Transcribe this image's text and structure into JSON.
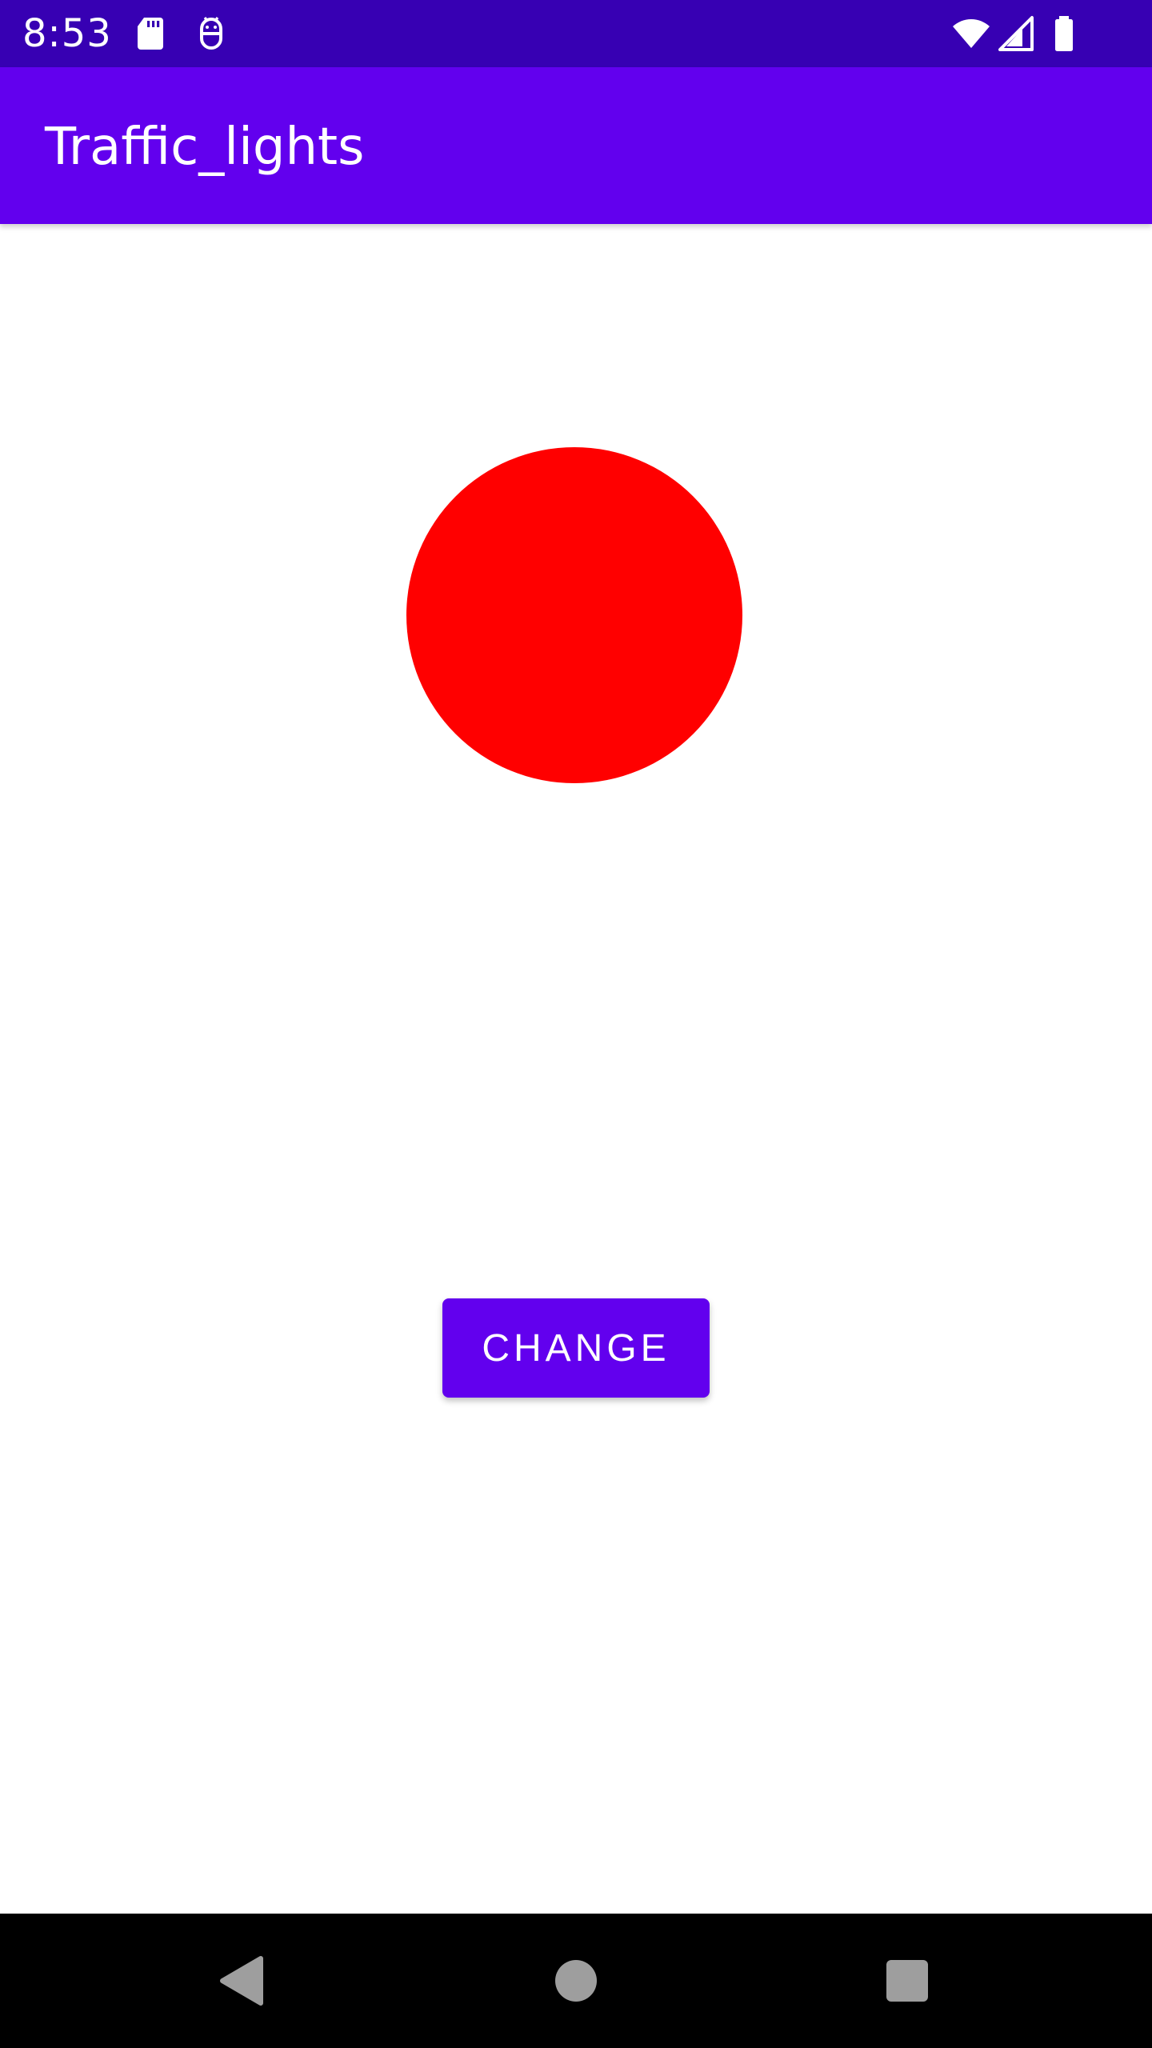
{
  "status_bar": {
    "time": "8:53",
    "icons": [
      "sd-card-icon",
      "android-debug-icon",
      "wifi-icon",
      "signal-icon",
      "battery-icon"
    ],
    "background_color": "#3700b3"
  },
  "app_bar": {
    "title": "Traffic_lights",
    "background_color": "#6200ee"
  },
  "traffic_light": {
    "current_color": "#ff0000"
  },
  "change_button": {
    "label": "CHANGE"
  },
  "nav_bar": {
    "buttons": [
      "back-icon",
      "home-icon",
      "recents-icon"
    ]
  }
}
